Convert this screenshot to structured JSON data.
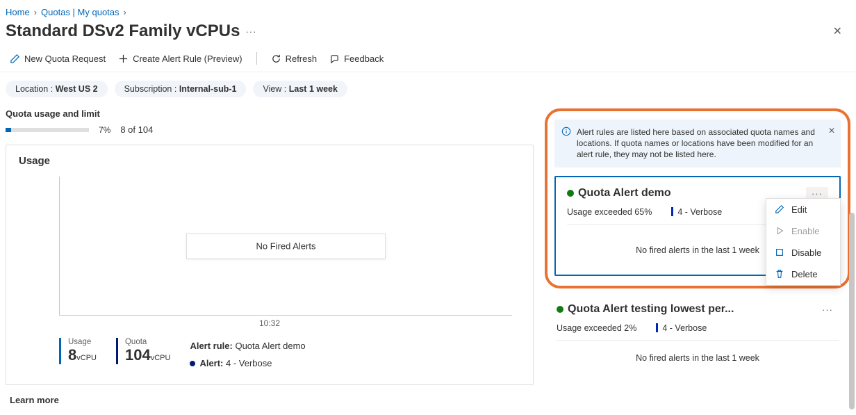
{
  "breadcrumb": {
    "home": "Home",
    "quotas": "Quotas | My quotas"
  },
  "page": {
    "title": "Standard DSv2 Family vCPUs"
  },
  "toolbar": {
    "new_request": "New Quota Request",
    "create_alert": "Create Alert Rule (Preview)",
    "refresh": "Refresh",
    "feedback": "Feedback"
  },
  "filters": {
    "location_key": "Location : ",
    "location_val": "West US 2",
    "subscription_key": "Subscription : ",
    "subscription_val": "Internal-sub-1",
    "view_key": "View : ",
    "view_val": "Last 1 week"
  },
  "usage_section_title": "Quota usage and limit",
  "usage_bar": {
    "pct_text": "7%",
    "detail": "8 of 104",
    "pct_value": 7
  },
  "usage_card": {
    "title": "Usage",
    "no_fired": "No Fired Alerts",
    "time_label": "10:32",
    "stat_usage_label": "Usage",
    "stat_usage_value": "8",
    "stat_usage_unit": "vCPU",
    "stat_quota_label": "Quota",
    "stat_quota_value": "104",
    "stat_quota_unit": "vCPU",
    "rule_label": "Alert rule:",
    "rule_value": " Quota Alert demo",
    "alert_label": "Alert:",
    "alert_value": " 4 - Verbose"
  },
  "learn_more": "Learn more",
  "info_banner": "Alert rules are listed here based on associated quota names and locations. If quota names or locations have been modified for an alert rule, they may not be listed here.",
  "alerts": [
    {
      "title": "Quota Alert demo",
      "condition": "Usage exceeded 65%",
      "severity": "4 - Verbose",
      "no_fired": "No fired alerts in the last 1 week"
    },
    {
      "title": "Quota Alert testing lowest per...",
      "condition": "Usage exceeded 2%",
      "severity": "4 - Verbose",
      "no_fired": "No fired alerts in the last 1 week"
    }
  ],
  "context_menu": {
    "edit": "Edit",
    "enable": "Enable",
    "disable": "Disable",
    "delete": "Delete"
  }
}
